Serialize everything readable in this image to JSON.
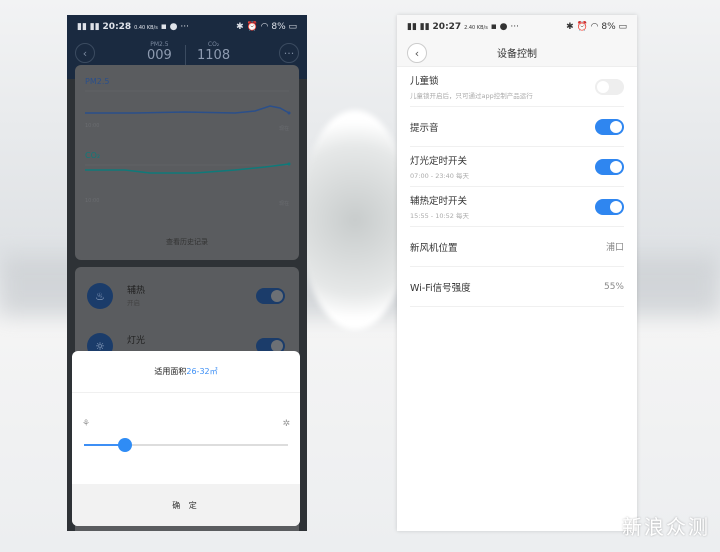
{
  "left_phone": {
    "status": {
      "time": "20:28",
      "speed": "0.40 KB/s",
      "battery": "8%"
    },
    "header": {
      "back_icon": "chevron-left",
      "more_icon": "ellipsis",
      "metrics": [
        {
          "label": "PM2.5",
          "value": "009"
        },
        {
          "label": "CO₂",
          "value": "1108"
        }
      ]
    },
    "charts": [
      {
        "title": "PM2.5",
        "x_start": "10:00",
        "x_end": "现在",
        "color": "#2b4f8a"
      },
      {
        "title": "CO₂",
        "x_start": "10:00",
        "x_end": "现在",
        "color": "#0f7a7a"
      }
    ],
    "history_link": "查看历史记录",
    "controls": [
      {
        "label": "辅热",
        "status": "开启",
        "icon": "heat-icon",
        "on": true
      },
      {
        "label": "灯光",
        "icon": "light-icon",
        "on": true
      }
    ],
    "popup": {
      "title": "适用面积",
      "area": "26-32㎡",
      "slider_percent": 20,
      "min_icon": "fan-low-icon",
      "max_icon": "fan-high-icon",
      "confirm": "确 定"
    }
  },
  "right_phone": {
    "status": {
      "time": "20:27",
      "speed": "2.40 KB/s",
      "battery": "8%"
    },
    "header": {
      "title": "设备控制",
      "back_icon": "chevron-left"
    },
    "rows": [
      {
        "label": "儿童锁",
        "sub": "儿童锁开启后，只可通过app控制产品运行",
        "toggle": false
      },
      {
        "label": "提示音",
        "toggle": true
      },
      {
        "label": "灯光定时开关",
        "sub": "07:00 - 23:40 每天",
        "toggle": true
      },
      {
        "label": "辅热定时开关",
        "sub": "15:55 - 10:52 每天",
        "toggle": true
      },
      {
        "label": "新风机位置",
        "value": "浦口"
      },
      {
        "label": "Wi-Fi信号强度",
        "value": "55%"
      }
    ]
  },
  "watermark": "新浪众测",
  "colors": {
    "accent": "#2f86f0",
    "dark_header": "#1a2a40"
  }
}
